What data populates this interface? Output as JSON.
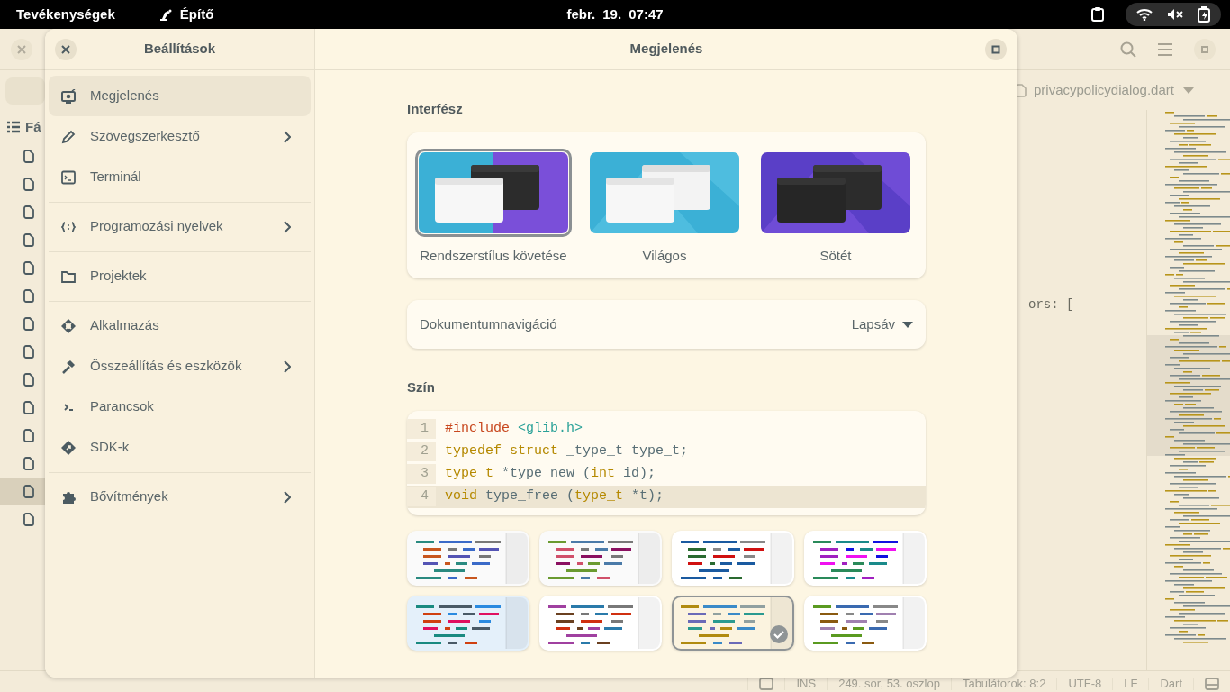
{
  "top_bar": {
    "activities": "Tevékenységek",
    "app_name": "Építő",
    "clock": "febr. 19. 07:47"
  },
  "background_window": {
    "file_tree": {
      "heading": "Fá",
      "files": [
        {
          "selected": false
        },
        {
          "selected": false
        },
        {
          "selected": false
        },
        {
          "selected": false
        },
        {
          "selected": false
        },
        {
          "selected": false
        },
        {
          "selected": false
        },
        {
          "selected": false
        },
        {
          "selected": false
        },
        {
          "selected": false
        },
        {
          "selected": false
        },
        {
          "selected": false
        },
        {
          "selected": true
        },
        {
          "selected": false
        }
      ]
    },
    "tab": {
      "title": "privacypolicydialog.dart"
    },
    "code_fragment": "ors: [",
    "status_bar": {
      "mode": "INS",
      "position": "249. sor, 53. oszlop",
      "indent": "Tabulátorok: 8:2",
      "encoding": "UTF-8",
      "line_ending": "LF",
      "language": "Dart"
    }
  },
  "dialog": {
    "sidebar": {
      "title": "Beállítások",
      "groups": [
        [
          {
            "label": "Megjelenés",
            "selected": true,
            "has_submenu": false
          },
          {
            "label": "Szövegszerkesztő",
            "selected": false,
            "has_submenu": true
          },
          {
            "label": "Terminál",
            "selected": false,
            "has_submenu": false
          }
        ],
        [
          {
            "label": "Programozási nyelvek",
            "selected": false,
            "has_submenu": true
          }
        ],
        [
          {
            "label": "Projektek",
            "selected": false,
            "has_submenu": false
          }
        ],
        [
          {
            "label": "Alkalmazás",
            "selected": false,
            "has_submenu": false
          },
          {
            "label": "Összeállítás és eszközök",
            "selected": false,
            "has_submenu": true
          },
          {
            "label": "Parancsok",
            "selected": false,
            "has_submenu": false
          },
          {
            "label": "SDK-k",
            "selected": false,
            "has_submenu": false
          }
        ],
        [
          {
            "label": "Bővítmények",
            "selected": false,
            "has_submenu": true
          }
        ]
      ]
    },
    "page": {
      "title": "Megjelenés",
      "interface": {
        "heading": "Interfész",
        "styles": [
          {
            "label": "Rendszerstílus követése",
            "kind": "system",
            "selected": true
          },
          {
            "label": "Világos",
            "kind": "light",
            "selected": false
          },
          {
            "label": "Sötét",
            "kind": "dark",
            "selected": false
          }
        ]
      },
      "navigation": {
        "label": "Dokumentumnavigáció",
        "value": "Lapsáv"
      },
      "color": {
        "heading": "Szín",
        "preview_lines": [
          {
            "number": "1",
            "current": false,
            "tokens": [
              {
                "text": "#include ",
                "kind": "preproc"
              },
              {
                "text": "<glib.h>",
                "kind": "string"
              }
            ]
          },
          {
            "number": "2",
            "current": false,
            "tokens": [
              {
                "text": "typedef struct ",
                "kind": "keyword"
              },
              {
                "text": "_type_t type_t;",
                "kind": "plain"
              }
            ]
          },
          {
            "number": "3",
            "current": false,
            "tokens": [
              {
                "text": "type_t",
                "kind": "keyword"
              },
              {
                "text": " *type_new (",
                "kind": "plain"
              },
              {
                "text": "int",
                "kind": "keyword"
              },
              {
                "text": " id);",
                "kind": "plain"
              }
            ]
          },
          {
            "number": "4",
            "current": true,
            "tokens": [
              {
                "text": "void",
                "kind": "keyword"
              },
              {
                "text": " type_free (",
                "kind": "plain"
              },
              {
                "text": "type_t",
                "kind": "keyword"
              },
              {
                "text": " *t);",
                "kind": "plain"
              }
            ]
          }
        ],
        "schemes": [
          {
            "color": "#fafafa",
            "selected": false
          },
          {
            "color": "#fafafa",
            "selected": false
          },
          {
            "color": "#ffffff",
            "selected": false
          },
          {
            "color": "#ffffff",
            "selected": false
          },
          {
            "color": "#e4f0fa",
            "selected": false
          },
          {
            "color": "#ffffff",
            "selected": false
          },
          {
            "color": "#fbf3df",
            "selected": true
          },
          {
            "color": "#ffffff",
            "selected": false
          }
        ]
      }
    }
  }
}
